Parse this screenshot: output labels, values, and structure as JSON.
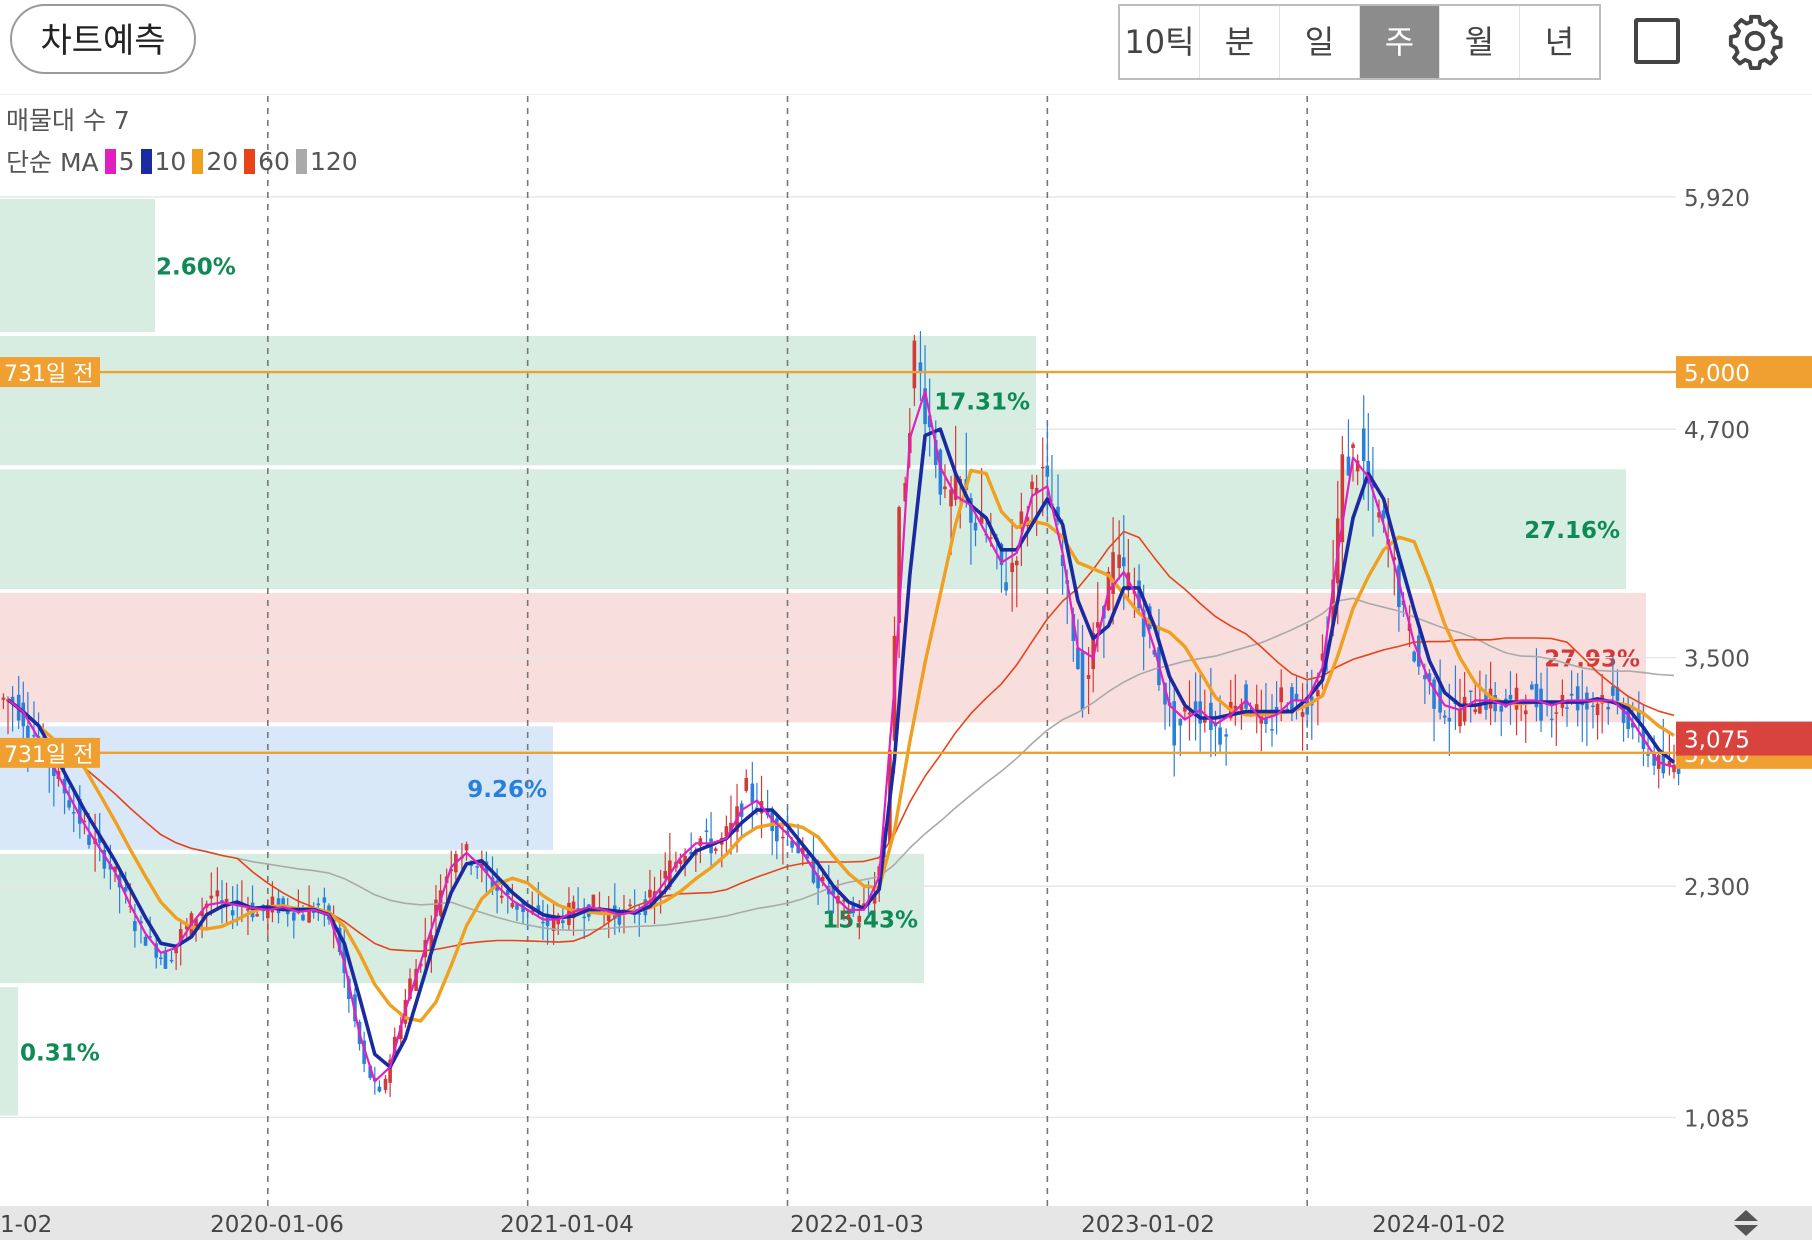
{
  "toolbar": {
    "predict_label": "차트예측",
    "periods": [
      "10틱",
      "분",
      "일",
      "주",
      "월",
      "년"
    ],
    "active_period": "주"
  },
  "legend": {
    "volume_profile": "매물대 수 7",
    "ma_label": "단순 MA",
    "ma_periods": [
      {
        "label": "5",
        "color": "#e020c0"
      },
      {
        "label": "10",
        "color": "#1a2aa0"
      },
      {
        "label": "20",
        "color": "#f0a020"
      },
      {
        "label": "60",
        "color": "#e8441a"
      },
      {
        "label": "120",
        "color": "#aaaaaa"
      }
    ]
  },
  "colors": {
    "up": "#d23a3a",
    "down": "#2a7fd8",
    "zone_green": "#d7ede2",
    "zone_red": "#f9dede",
    "zone_blue": "#d9e8f8",
    "pct_green": "#0e8a55",
    "pct_blue": "#2a7fd8",
    "pct_red": "#d23a3a",
    "ref_line": "#f0a030",
    "price_tag": "#d8433e"
  },
  "chart_data": {
    "type": "candlestick",
    "x_ticks": [
      "1-02",
      "2020-01-06",
      "2021-01-04",
      "2022-01-03",
      "2023-01-02",
      "2024-01-02"
    ],
    "y_ticks": [
      5920,
      4700,
      3500,
      2300,
      1085
    ],
    "ylim": [
      620,
      6450
    ],
    "grid": true,
    "volume_profile_zones": [
      {
        "low": 5200,
        "high": 5920,
        "pct": "2.60%",
        "tone": "green"
      },
      {
        "low": 4500,
        "high": 5200,
        "pct": "17.31%",
        "tone": "green"
      },
      {
        "low": 3850,
        "high": 4500,
        "pct": "27.16%",
        "tone": "green"
      },
      {
        "low": 3150,
        "high": 3850,
        "pct": "27.93%",
        "tone": "red"
      },
      {
        "low": 2480,
        "high": 3150,
        "pct": "9.26%",
        "tone": "blue"
      },
      {
        "low": 1780,
        "high": 2480,
        "pct": "15.43%",
        "tone": "green"
      },
      {
        "low": 1085,
        "high": 1780,
        "pct": "0.31%",
        "tone": "green"
      }
    ],
    "reference_lines": [
      {
        "value": 5000,
        "label": "731일 전",
        "price_label": "5,000"
      },
      {
        "value": 3000,
        "label": "731일 전",
        "price_label": "3,000"
      }
    ],
    "current_price": {
      "value": 3075,
      "label": "3,075"
    },
    "closes": [
      3280,
      3150,
      3000,
      2850,
      2700,
      2550,
      2450,
      2300,
      2100,
      2000,
      1900,
      2050,
      2150,
      2250,
      2180,
      2220,
      2150,
      2200,
      2180,
      2150,
      2200,
      2100,
      1700,
      1350,
      1200,
      1500,
      1800,
      2000,
      2300,
      2500,
      2450,
      2350,
      2250,
      2200,
      2150,
      2100,
      2150,
      2180,
      2200,
      2150,
      2150,
      2180,
      2250,
      2400,
      2500,
      2550,
      2500,
      2600,
      2800,
      2700,
      2600,
      2550,
      2400,
      2300,
      2200,
      2150,
      2200,
      2500,
      4200,
      5100,
      4700,
      4300,
      4400,
      4200,
      4100,
      3900,
      4200,
      4500,
      4300,
      3800,
      3300,
      3700,
      4000,
      3900,
      3700,
      3400,
      3100,
      3250,
      3200,
      3100,
      3300,
      3250,
      3100,
      3300,
      3250,
      3300,
      3600,
      4500,
      4600,
      4300,
      4100,
      3700,
      3450,
      3300,
      3200,
      3250,
      3300,
      3250,
      3250,
      3300,
      3250,
      3250,
      3300,
      3250,
      3300,
      3250,
      3150,
      3000,
      2900,
      2950
    ]
  }
}
